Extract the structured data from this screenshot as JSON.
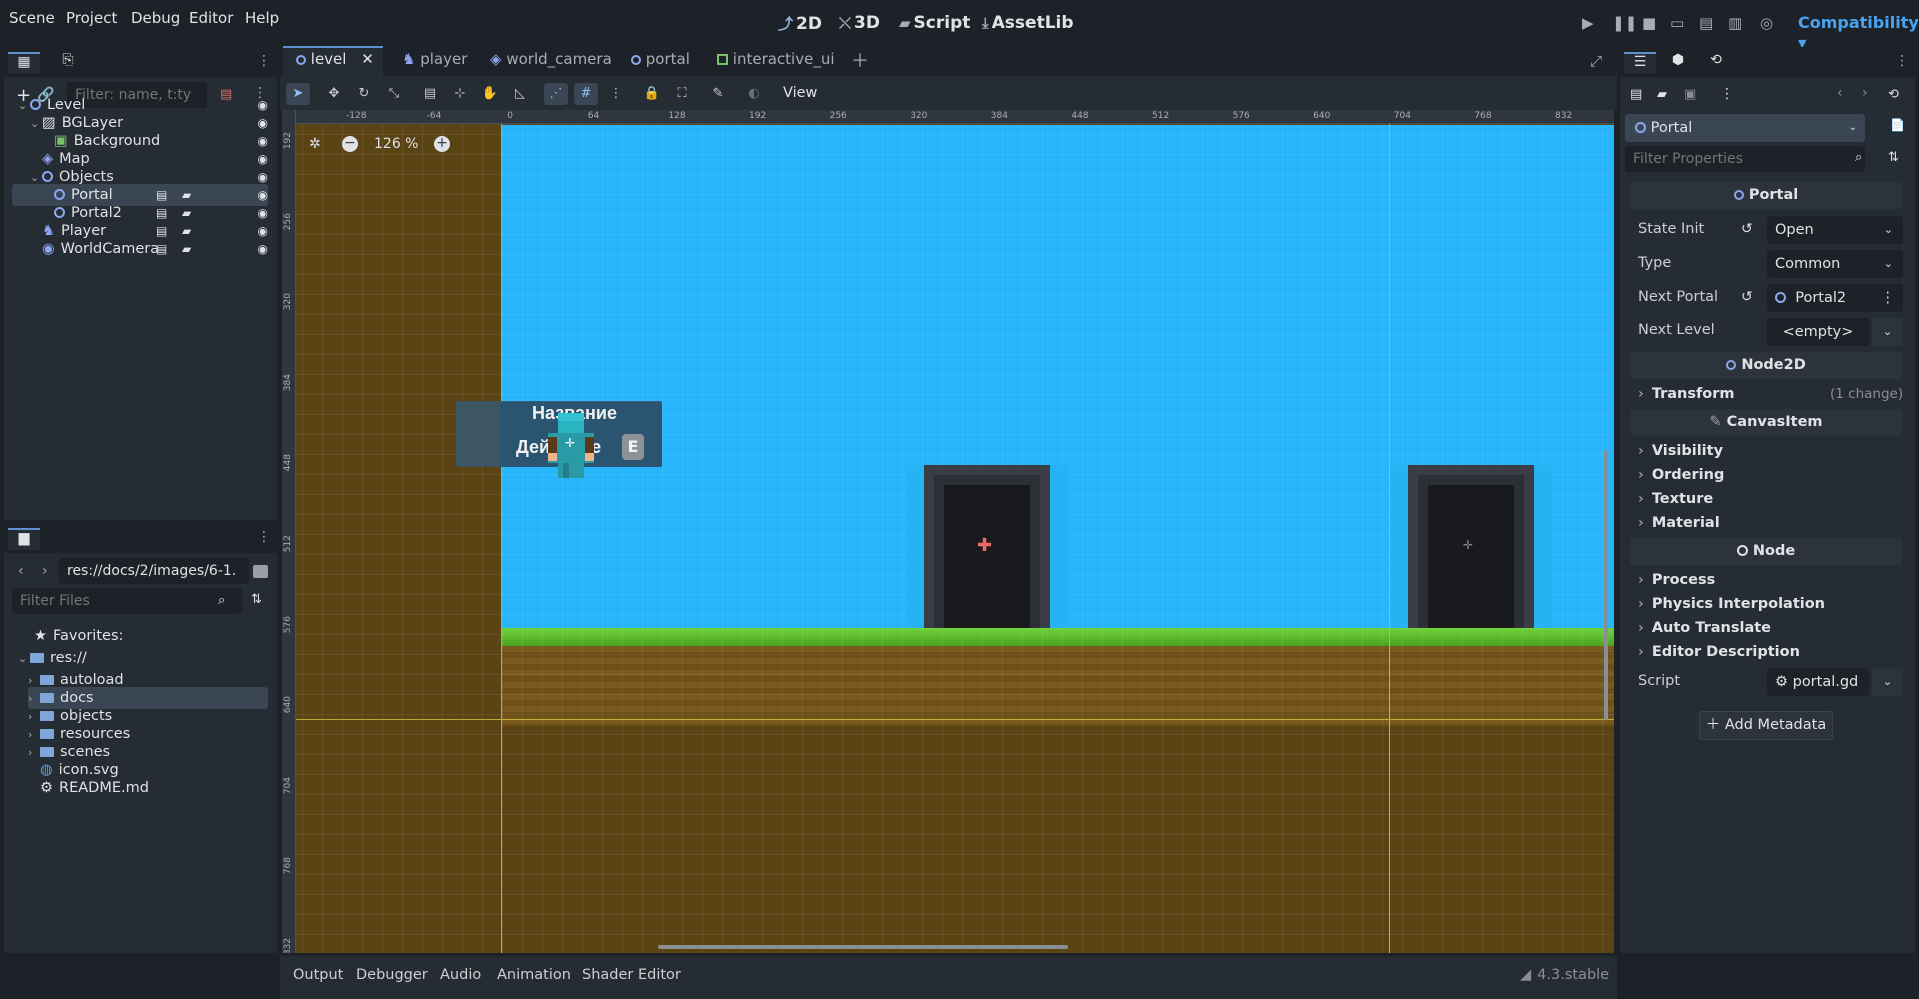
{
  "menu": [
    "Scene",
    "Project",
    "Debug",
    "Editor",
    "Help"
  ],
  "modes": {
    "m2d": "2D",
    "m3d": "3D",
    "script": "Script",
    "assetlib": "AssetLib"
  },
  "renderer": "Compatibility",
  "scene_dock": {
    "filter_placeholder": "Filter: name, t:ty",
    "nodes": [
      {
        "label": "Level",
        "depth": 0,
        "expanded": true
      },
      {
        "label": "BGLayer",
        "depth": 1,
        "expanded": true
      },
      {
        "label": "Background",
        "depth": 2
      },
      {
        "label": "Map",
        "depth": 1
      },
      {
        "label": "Objects",
        "depth": 1,
        "expanded": true
      },
      {
        "label": "Portal",
        "depth": 2,
        "selected": true
      },
      {
        "label": "Portal2",
        "depth": 2
      },
      {
        "label": "Player",
        "depth": 1
      },
      {
        "label": "WorldCamera",
        "depth": 1
      }
    ]
  },
  "filesystem": {
    "path": "res://docs/2/images/6-1.",
    "filter_placeholder": "Filter Files",
    "favorites": "Favorites:",
    "root": "res://",
    "items": [
      "autoload",
      "docs",
      "objects",
      "resources",
      "scenes",
      "icon.svg",
      "README.md"
    ]
  },
  "scene_tabs": [
    "level",
    "player",
    "world_camera",
    "portal",
    "interactive_ui"
  ],
  "toolbar": {
    "view": "View"
  },
  "viewport": {
    "zoom": "126 %",
    "ruler_top": [
      "-128",
      "-64",
      "0",
      "64",
      "128",
      "192",
      "256",
      "320",
      "384",
      "448",
      "512",
      "576",
      "640",
      "704",
      "768",
      "832"
    ],
    "ruler_left": [
      "192",
      "256",
      "320",
      "384",
      "448",
      "512",
      "576",
      "640",
      "704",
      "768",
      "832"
    ],
    "ui_title": "Название",
    "ui_action": "Действие",
    "ui_key": "E"
  },
  "bottom_panel": {
    "tabs": [
      "Output",
      "Debugger",
      "Audio",
      "Animation",
      "Shader Editor"
    ],
    "version": "4.3.stable"
  },
  "inspector": {
    "node_name": "Portal",
    "filter_placeholder": "Filter Properties",
    "class_header": "Portal",
    "props": {
      "state_init": {
        "label": "State Init",
        "value": "Open"
      },
      "type": {
        "label": "Type",
        "value": "Common"
      },
      "next_portal": {
        "label": "Next Portal",
        "value": "Portal2"
      },
      "next_level": {
        "label": "Next Level",
        "value": "<empty>"
      }
    },
    "node2d": "Node2D",
    "transform": "Transform",
    "transform_note": "(1 change)",
    "canvasitem": "CanvasItem",
    "canvas_groups": [
      "Visibility",
      "Ordering",
      "Texture",
      "Material"
    ],
    "node": "Node",
    "node_groups": [
      "Process",
      "Physics Interpolation",
      "Auto Translate",
      "Editor Description"
    ],
    "script": {
      "label": "Script",
      "value": "portal.gd"
    },
    "add_metadata": "Add Metadata"
  }
}
